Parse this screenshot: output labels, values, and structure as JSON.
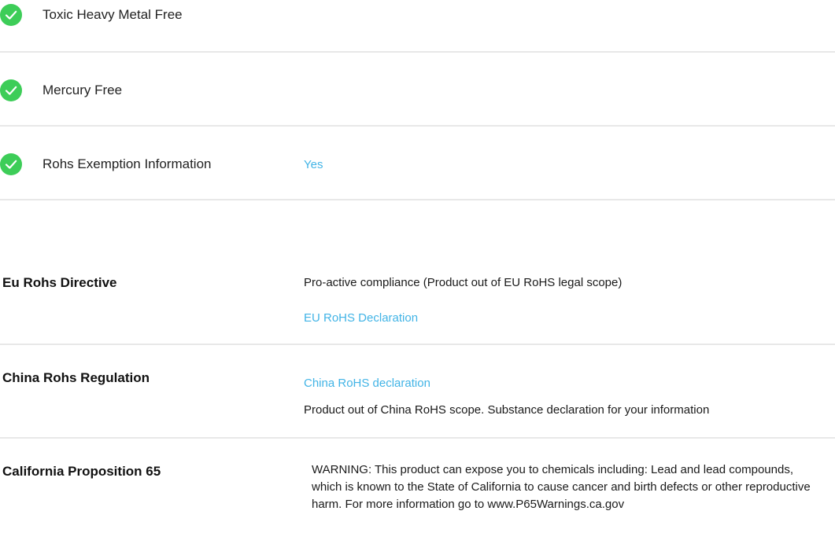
{
  "environmental_checks": [
    {
      "label": "Toxic Heavy Metal Free",
      "value": "",
      "icon": "check-circle-icon"
    },
    {
      "label": "Mercury Free",
      "value": "",
      "icon": "check-circle-icon"
    },
    {
      "label": "Rohs Exemption Information",
      "value": "Yes",
      "icon": "check-circle-icon"
    }
  ],
  "regulations": {
    "eu_rohs": {
      "title": "Eu Rohs Directive",
      "description": "Pro-active compliance (Product out of EU RoHS legal scope)",
      "link": "EU RoHS Declaration"
    },
    "china_rohs": {
      "title": "China Rohs Regulation",
      "link": "China RoHS declaration",
      "description": "Product out of China RoHS scope. Substance declaration for your information"
    },
    "california_prop65": {
      "title": "California Proposition 65",
      "warning": "WARNING: This product can expose you to chemicals including: Lead and lead compounds, which is known to the State of California to cause cancer and birth defects or other reproductive harm. For more information go to www.P65Warnings.ca.gov"
    }
  },
  "colors": {
    "check_green": "#3dcd58",
    "link_blue": "#42b4e6",
    "divider_gray": "#e8e8e8"
  }
}
